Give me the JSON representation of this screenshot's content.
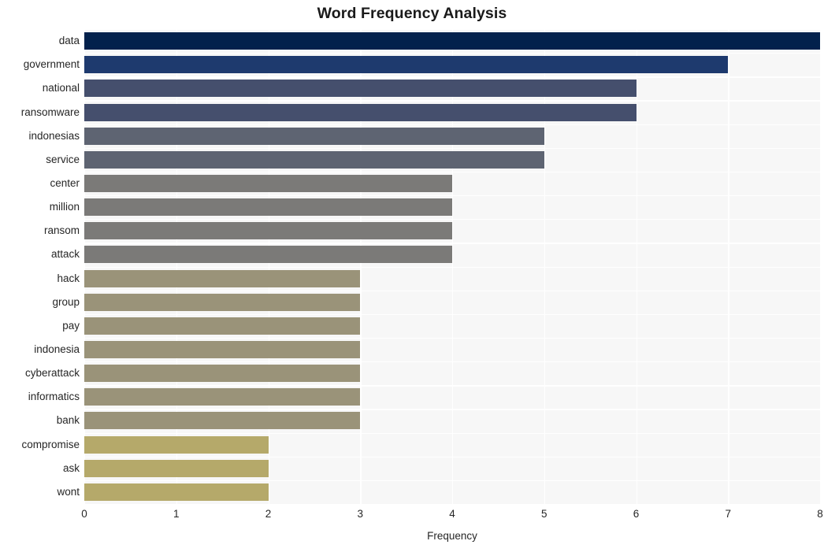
{
  "chart_data": {
    "type": "bar",
    "orientation": "horizontal",
    "title": "Word Frequency Analysis",
    "xlabel": "Frequency",
    "ylabel": "",
    "xlim": [
      0,
      8
    ],
    "ylim": null,
    "grid": true,
    "legend": null,
    "xticks": [
      "0",
      "1",
      "2",
      "3",
      "4",
      "5",
      "6",
      "7",
      "8"
    ],
    "xtick_values": [
      0,
      1,
      2,
      3,
      4,
      5,
      6,
      7,
      8
    ],
    "categories": [
      "data",
      "government",
      "national",
      "ransomware",
      "indonesias",
      "service",
      "center",
      "million",
      "ransom",
      "attack",
      "hack",
      "group",
      "pay",
      "indonesia",
      "cyberattack",
      "informatics",
      "bank",
      "compromise",
      "ask",
      "wont"
    ],
    "values": [
      8,
      7,
      6,
      6,
      5,
      5,
      4,
      4,
      4,
      4,
      3,
      3,
      3,
      3,
      3,
      3,
      3,
      2,
      2,
      2
    ],
    "bar_colors": [
      "#03214c",
      "#1e3a6e",
      "#454f6d",
      "#454f6d",
      "#5e6472",
      "#5e6472",
      "#7b7a78",
      "#7b7a78",
      "#7b7a78",
      "#7b7a78",
      "#9a9379",
      "#9a9379",
      "#9a9379",
      "#9a9379",
      "#9a9379",
      "#9a9379",
      "#9a9379",
      "#b5a96a",
      "#b5a96a",
      "#b5a96a"
    ],
    "plot_background": "#f7f7f7",
    "grid_color": "#ffffff",
    "figure_background": "#ffffff"
  }
}
